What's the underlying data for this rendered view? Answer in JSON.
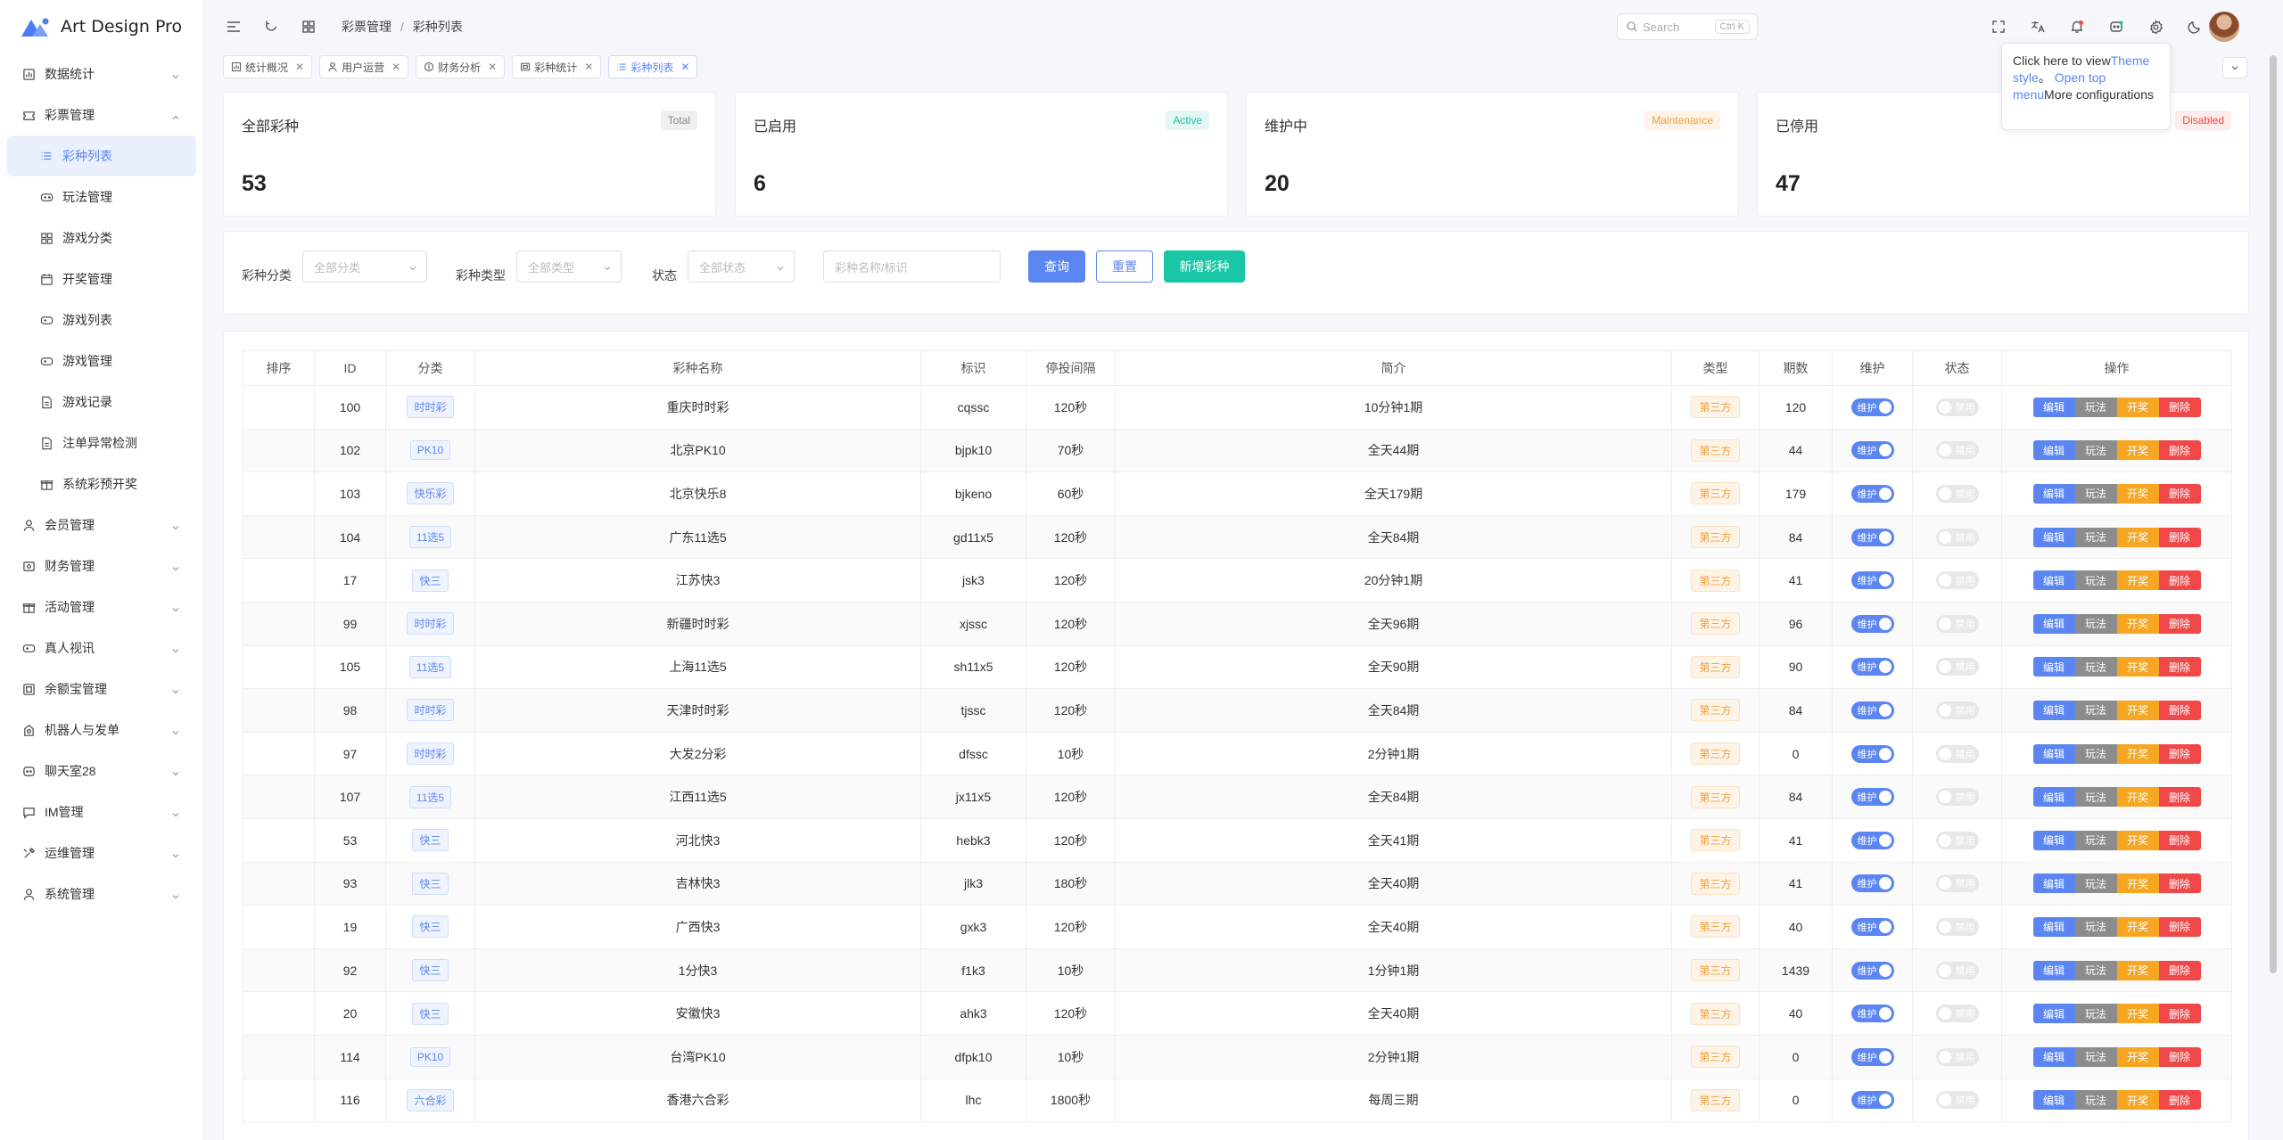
{
  "app": {
    "title": "Art Design Pro"
  },
  "colors": {
    "primary": "#5b86f2",
    "active_badge": "#19c6a5",
    "maintenance_badge": "#f0a040",
    "disabled_badge": "#f04848"
  },
  "sidebar": {
    "items": [
      {
        "label": "数据统计",
        "icon": "chart-icon",
        "expanded": false
      },
      {
        "label": "彩票管理",
        "icon": "ticket-icon",
        "expanded": true
      },
      {
        "label": "会员管理",
        "icon": "user-icon",
        "expanded": false
      },
      {
        "label": "财务管理",
        "icon": "finance-icon",
        "expanded": false
      },
      {
        "label": "活动管理",
        "icon": "gift-icon",
        "expanded": false
      },
      {
        "label": "真人视讯",
        "icon": "gamepad-icon",
        "expanded": false
      },
      {
        "label": "余额宝管理",
        "icon": "wallet-icon",
        "expanded": false
      },
      {
        "label": "机器人与发单",
        "icon": "robot-icon",
        "expanded": false
      },
      {
        "label": "聊天室28",
        "icon": "chat-bot-icon",
        "expanded": false
      },
      {
        "label": "IM管理",
        "icon": "message-icon",
        "expanded": false
      },
      {
        "label": "运维管理",
        "icon": "tools-icon",
        "expanded": false
      },
      {
        "label": "系统管理",
        "icon": "user-icon",
        "expanded": false
      }
    ],
    "sub_items": [
      {
        "label": "彩种列表",
        "icon": "list-icon",
        "active": true
      },
      {
        "label": "玩法管理",
        "icon": "gamepad-icon"
      },
      {
        "label": "游戏分类",
        "icon": "grid-icon"
      },
      {
        "label": "开奖管理",
        "icon": "calendar-icon"
      },
      {
        "label": "游戏列表",
        "icon": "gamepad-icon"
      },
      {
        "label": "游戏管理",
        "icon": "gamepad-icon"
      },
      {
        "label": "游戏记录",
        "icon": "document-icon"
      },
      {
        "label": "注单异常检测",
        "icon": "document-icon"
      },
      {
        "label": "系统彩预开奖",
        "icon": "gift-icon"
      }
    ]
  },
  "header": {
    "breadcrumb": [
      "彩票管理",
      "彩种列表"
    ],
    "search": {
      "placeholder": "Search",
      "shortcut": "Ctrl K"
    }
  },
  "tabs": [
    {
      "label": "统计概况",
      "icon": "chart-icon"
    },
    {
      "label": "用户运营",
      "icon": "user-icon"
    },
    {
      "label": "财务分析",
      "icon": "finance-icon"
    },
    {
      "label": "彩种统计",
      "icon": "ticket-icon"
    },
    {
      "label": "彩种列表",
      "icon": "list-icon",
      "active": true
    }
  ],
  "tooltip": {
    "part1": "Click here to view",
    "link1": "Theme style",
    "part2": "。",
    "link2": "Open top menu",
    "part3": "More configurations"
  },
  "stats": [
    {
      "title": "全部彩种",
      "badge": "Total",
      "value": "53"
    },
    {
      "title": "已启用",
      "badge": "Active",
      "value": "6"
    },
    {
      "title": "维护中",
      "badge": "Maintenance",
      "value": "20"
    },
    {
      "title": "已停用",
      "badge": "Disabled",
      "value": "47"
    }
  ],
  "filter": {
    "category_label": "彩种分类",
    "category_placeholder": "全部分类",
    "type_label": "彩种类型",
    "type_placeholder": "全部类型",
    "status_label": "状态",
    "status_placeholder": "全部状态",
    "name_placeholder": "彩种名称/标识",
    "query_button": "查询",
    "reset_button": "重置",
    "add_button": "新增彩种"
  },
  "table": {
    "columns": [
      "排序",
      "ID",
      "分类",
      "彩种名称",
      "标识",
      "停投间隔",
      "简介",
      "类型",
      "期数",
      "维护",
      "状态",
      "操作"
    ],
    "toggle_on_label": "维护",
    "toggle_off_label": "禁用",
    "ops": [
      "编辑",
      "玩法",
      "开奖",
      "删除"
    ],
    "rows": [
      {
        "sort": "",
        "id": "100",
        "category": "时时彩",
        "name": "重庆时时彩",
        "code": "cqssc",
        "interval": "120秒",
        "desc": "10分钟1期",
        "type": "第三方",
        "periods": "120"
      },
      {
        "sort": "",
        "id": "102",
        "category": "PK10",
        "name": "北京PK10",
        "code": "bjpk10",
        "interval": "70秒",
        "desc": "全天44期",
        "type": "第三方",
        "periods": "44"
      },
      {
        "sort": "",
        "id": "103",
        "category": "快乐彩",
        "name": "北京快乐8",
        "code": "bjkeno",
        "interval": "60秒",
        "desc": "全天179期",
        "type": "第三方",
        "periods": "179"
      },
      {
        "sort": "",
        "id": "104",
        "category": "11选5",
        "name": "广东11选5",
        "code": "gd11x5",
        "interval": "120秒",
        "desc": "全天84期",
        "type": "第三方",
        "periods": "84"
      },
      {
        "sort": "",
        "id": "17",
        "category": "快三",
        "name": "江苏快3",
        "code": "jsk3",
        "interval": "120秒",
        "desc": "20分钟1期",
        "type": "第三方",
        "periods": "41"
      },
      {
        "sort": "",
        "id": "99",
        "category": "时时彩",
        "name": "新疆时时彩",
        "code": "xjssc",
        "interval": "120秒",
        "desc": "全天96期",
        "type": "第三方",
        "periods": "96"
      },
      {
        "sort": "",
        "id": "105",
        "category": "11选5",
        "name": "上海11选5",
        "code": "sh11x5",
        "interval": "120秒",
        "desc": "全天90期",
        "type": "第三方",
        "periods": "90"
      },
      {
        "sort": "",
        "id": "98",
        "category": "时时彩",
        "name": "天津时时彩",
        "code": "tjssc",
        "interval": "120秒",
        "desc": "全天84期",
        "type": "第三方",
        "periods": "84"
      },
      {
        "sort": "",
        "id": "97",
        "category": "时时彩",
        "name": "大发2分彩",
        "code": "dfssc",
        "interval": "10秒",
        "desc": "2分钟1期",
        "type": "第三方",
        "periods": "0"
      },
      {
        "sort": "",
        "id": "107",
        "category": "11选5",
        "name": "江西11选5",
        "code": "jx11x5",
        "interval": "120秒",
        "desc": "全天84期",
        "type": "第三方",
        "periods": "84"
      },
      {
        "sort": "",
        "id": "53",
        "category": "快三",
        "name": "河北快3",
        "code": "hebk3",
        "interval": "120秒",
        "desc": "全天41期",
        "type": "第三方",
        "periods": "41"
      },
      {
        "sort": "",
        "id": "93",
        "category": "快三",
        "name": "吉林快3",
        "code": "jlk3",
        "interval": "180秒",
        "desc": "全天40期",
        "type": "第三方",
        "periods": "41"
      },
      {
        "sort": "",
        "id": "19",
        "category": "快三",
        "name": "广西快3",
        "code": "gxk3",
        "interval": "120秒",
        "desc": "全天40期",
        "type": "第三方",
        "periods": "40"
      },
      {
        "sort": "",
        "id": "92",
        "category": "快三",
        "name": "1分快3",
        "code": "f1k3",
        "interval": "10秒",
        "desc": "1分钟1期",
        "type": "第三方",
        "periods": "1439"
      },
      {
        "sort": "",
        "id": "20",
        "category": "快三",
        "name": "安徽快3",
        "code": "ahk3",
        "interval": "120秒",
        "desc": "全天40期",
        "type": "第三方",
        "periods": "40"
      },
      {
        "sort": "",
        "id": "114",
        "category": "PK10",
        "name": "台湾PK10",
        "code": "dfpk10",
        "interval": "10秒",
        "desc": "2分钟1期",
        "type": "第三方",
        "periods": "0"
      },
      {
        "sort": "",
        "id": "116",
        "category": "六合彩",
        "name": "香港六合彩",
        "code": "lhc",
        "interval": "1800秒",
        "desc": "每周三期",
        "type": "第三方",
        "periods": "0"
      }
    ]
  }
}
